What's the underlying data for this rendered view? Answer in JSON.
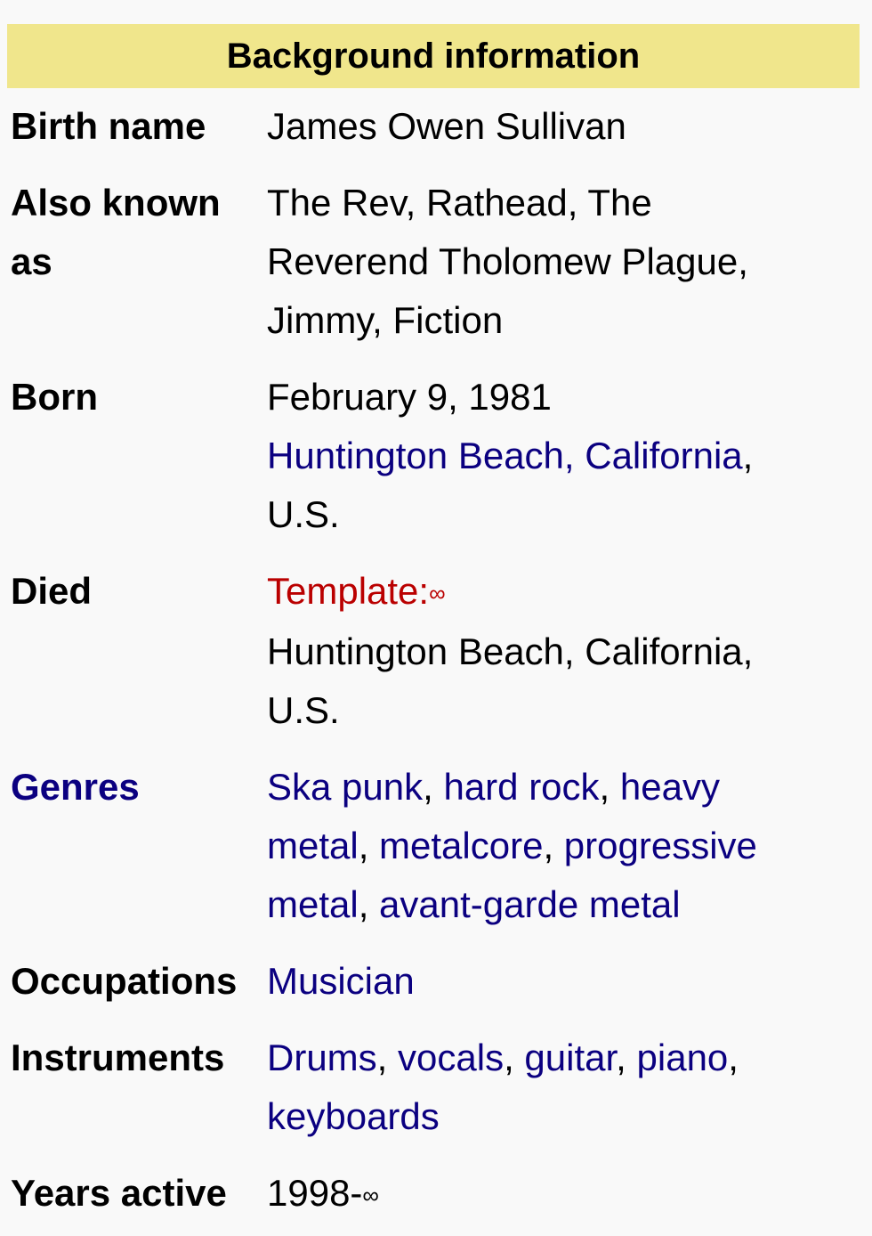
{
  "infobox": {
    "header": "Background information",
    "rows": [
      {
        "label": "Birth name",
        "value": "James Owen Sullivan"
      },
      {
        "label": "Also known as",
        "value": "The Rev, Rathead, The Reverend Tholomew Plague, Jimmy, Fiction"
      },
      {
        "label": "Born",
        "date": "February 9, 1981",
        "place_link": "Huntington Beach, California",
        "place_suffix": ", U.S."
      },
      {
        "label": "Died",
        "template_link": "Template:",
        "template_sym": "∞",
        "place": "Huntington Beach, California, U.S."
      },
      {
        "label": "Genres",
        "items": [
          {
            "text": "Ska punk",
            "link": true
          },
          {
            "text": ", ",
            "link": false
          },
          {
            "text": "hard rock",
            "link": true
          },
          {
            "text": ", ",
            "link": false
          },
          {
            "text": "heavy metal",
            "link": true
          },
          {
            "text": ", ",
            "link": false
          },
          {
            "text": "metalcore",
            "link": true
          },
          {
            "text": ", ",
            "link": false
          },
          {
            "text": "progressive metal",
            "link": true
          },
          {
            "text": ", ",
            "link": false
          },
          {
            "text": "avant-garde metal",
            "link": true
          }
        ]
      },
      {
        "label": "Occupations",
        "value": "Musician"
      },
      {
        "label": "Instruments",
        "items": [
          {
            "text": "Drums",
            "link": true
          },
          {
            "text": ", ",
            "link": false
          },
          {
            "text": "vocals",
            "link": true
          },
          {
            "text": ", ",
            "link": false
          },
          {
            "text": "guitar",
            "link": true
          },
          {
            "text": ", ",
            "link": false
          },
          {
            "text": "piano",
            "link": true
          },
          {
            "text": ", ",
            "link": false
          },
          {
            "text": "keyboards",
            "link": true
          }
        ]
      },
      {
        "label": "Years active",
        "value": "1998-",
        "sym": "∞"
      }
    ]
  },
  "colors": {
    "header_bg": "#f0e68c",
    "link": "#0b0080",
    "redlink": "#ba0000"
  }
}
